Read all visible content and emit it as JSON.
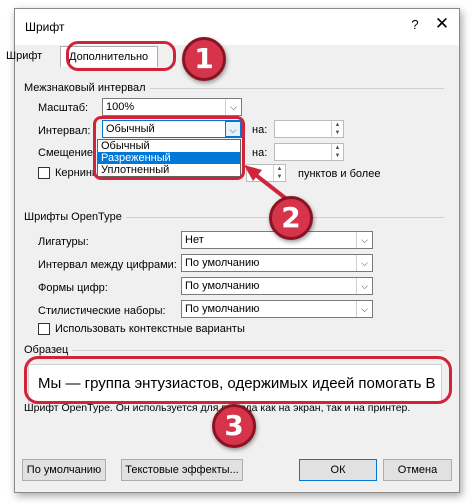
{
  "dialog": {
    "title": "Шрифт",
    "help": "?",
    "close": "✕"
  },
  "tabs": [
    {
      "label": "Шрифт"
    },
    {
      "label": "Дополнительно"
    }
  ],
  "spacing_group": {
    "title": "Межзнаковый интервал",
    "scale_label": "Масштаб:",
    "scale_value": "100%",
    "interval_label": "Интервал:",
    "interval_value": "Обычный",
    "on_label_1": "на:",
    "offset_label": "Смещение:",
    "on_label_2": "на:",
    "kerning_label": "Кернинг",
    "kerning_suffix": "пунктов и более",
    "dropdown_options": [
      "Обычный",
      "Разреженный",
      "Уплотненный"
    ],
    "dropdown_selected": "Разреженный"
  },
  "opentype_group": {
    "title": "Шрифты OpenType",
    "ligatures_label": "Лигатуры:",
    "ligatures_value": "Нет",
    "digit_spacing_label": "Интервал между цифрами:",
    "digit_spacing_value": "По умолчанию",
    "digit_forms_label": "Формы цифр:",
    "digit_forms_value": "По умолчанию",
    "stylistic_label": "Стилистические наборы:",
    "stylistic_value": "По умолчанию",
    "contextual_label": "Использовать контекстные варианты"
  },
  "sample_group": {
    "title": "Образец",
    "sample_text": "Мы — группа энтузиастов, одержимых идеей помогать В",
    "description": "Шрифт OpenType. Он используется для вывода как на экран, так и на принтер."
  },
  "buttons": {
    "default": "По умолчанию",
    "text_effects": "Текстовые эффекты...",
    "ok": "ОК",
    "cancel": "Отмена"
  },
  "annotations": {
    "badge_1": "1",
    "badge_2": "2",
    "badge_3": "3",
    "accent_color": "#d6344a"
  }
}
